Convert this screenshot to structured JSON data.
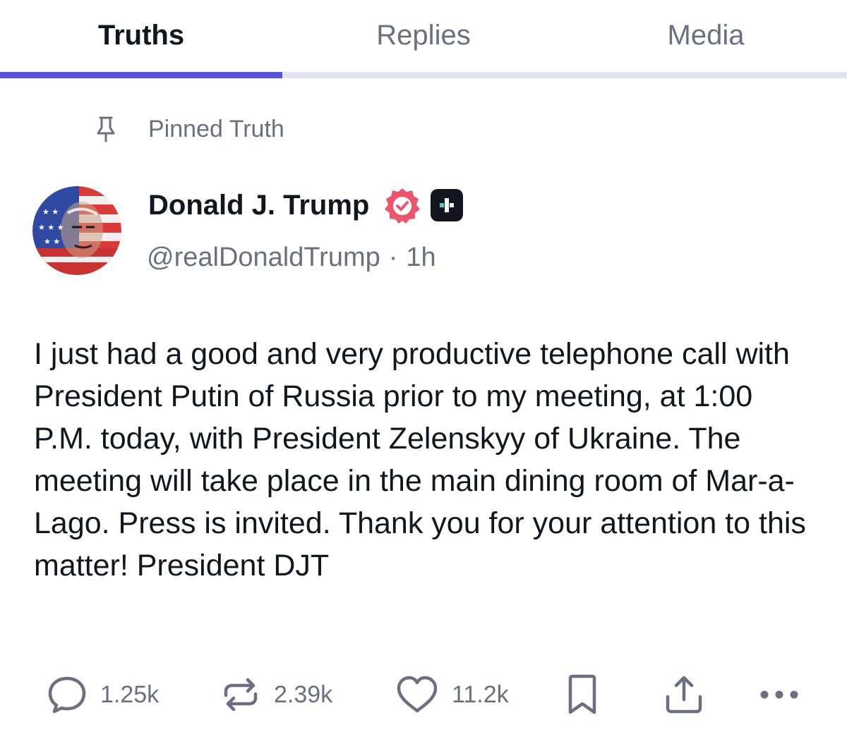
{
  "tabs": [
    {
      "label": "Truths",
      "active": true
    },
    {
      "label": "Replies",
      "active": false
    },
    {
      "label": "Media",
      "active": false
    }
  ],
  "colors": {
    "accent": "#5b52d6",
    "tab_track": "#e3e3f4",
    "verified": "#e9566e",
    "muted_text": "#6b6f80",
    "primary_text": "#14161f"
  },
  "pinned": {
    "icon": "pin-icon",
    "label": "Pinned Truth"
  },
  "post": {
    "author": {
      "display_name": "Donald J. Trump",
      "handle": "@realDonaldTrump",
      "separator": "·",
      "time": "1h",
      "badges": [
        "verified-badge-icon",
        "truth-plus-icon"
      ]
    },
    "body": "I just had a good and very productive telephone call with President Putin of Russia prior to my meeting, at 1:00 P.M. today, with President Zelenskyy of Ukraine. The meeting will take place in the main dining room of Mar-a-Lago. Press is invited. Thank you for your attention to this matter! President DJT",
    "stats": {
      "replies": "1.25k",
      "retruths": "2.39k",
      "likes": "11.2k"
    }
  },
  "actions": [
    {
      "name": "reply",
      "icon": "reply-icon"
    },
    {
      "name": "retruth",
      "icon": "retruth-icon"
    },
    {
      "name": "like",
      "icon": "heart-icon"
    },
    {
      "name": "bookmark",
      "icon": "bookmark-icon"
    },
    {
      "name": "share",
      "icon": "share-icon"
    },
    {
      "name": "more",
      "icon": "more-icon"
    }
  ]
}
